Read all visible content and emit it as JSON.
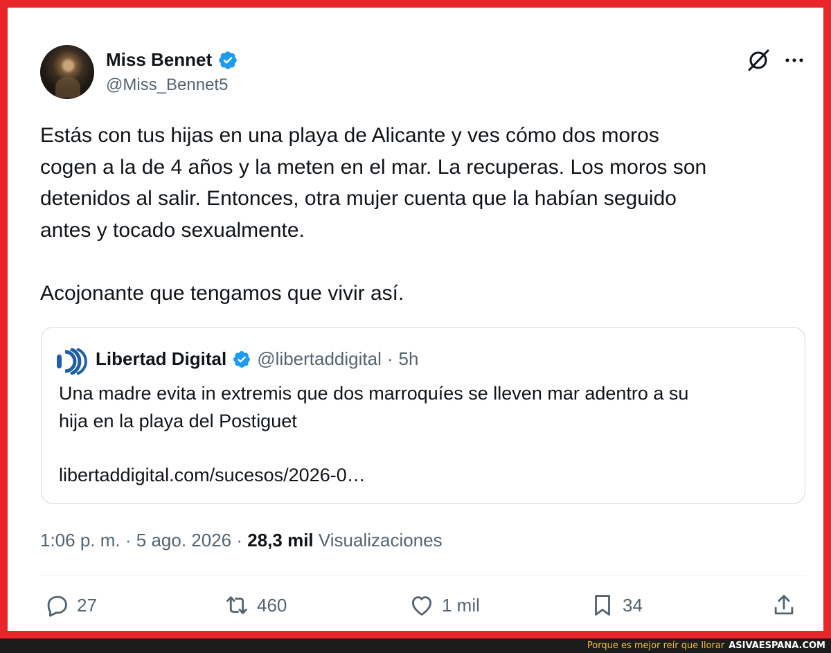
{
  "tweet": {
    "author": {
      "display_name": "Miss Bennet",
      "handle": "@Miss_Bennet5",
      "verified": true
    },
    "text": "Estás con tus hijas en una playa de Alicante y ves cómo dos moros\ncogen a la de 4 años y la meten en el mar. La recuperas. Los moros son\ndetenidos al salir. Entonces, otra mujer cuenta que la habían seguido\nantes y tocado sexualmente.\n\nAcojonante que tengamos que vivir así.",
    "time": "1:06 p. m.",
    "date": "5 ago. 2026",
    "separator": "·",
    "views_count": "28,3 mil",
    "views_label": "Visualizaciones"
  },
  "quoted_tweet": {
    "display_name": "Libertad Digital",
    "handle": "@libertaddigital",
    "separator": "·",
    "age": "5h",
    "text": "Una madre evita in extremis que dos marroquíes se lleven mar adentro a su\nhija en la playa del Postiguet",
    "link": "libertaddigital.com/sucesos/2026-0…"
  },
  "actions": {
    "replies": "27",
    "retweets": "460",
    "likes": "1 mil",
    "bookmarks": "34"
  },
  "footer": {
    "slogan": "Porque es mejor reír que llorar",
    "site": "ASIVAESPANA.COM"
  },
  "colors": {
    "frame": "#e8262a",
    "verified": "#1d9bf0",
    "secondary_text": "#536471",
    "border": "#cfd9de"
  },
  "icons": [
    "verified-badge-icon",
    "grok-icon",
    "more-icon",
    "reply-icon",
    "retweet-icon",
    "like-icon",
    "bookmark-icon",
    "share-icon",
    "libertad-digital-logo"
  ]
}
